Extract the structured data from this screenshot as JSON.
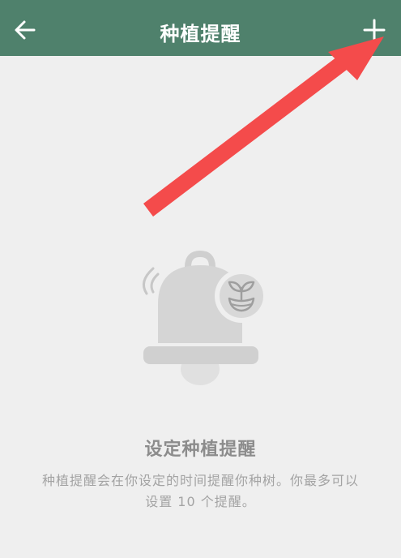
{
  "header": {
    "title": "种植提醒",
    "back_icon": "arrow-left-icon",
    "add_icon": "plus-icon",
    "background_color": "#4f816c"
  },
  "annotation": {
    "arrow_color": "#f44b4b",
    "points_to": "add-button"
  },
  "empty_state": {
    "illustration_icon": "bell-with-sprout-icon",
    "title": "设定种植提醒",
    "description": "种植提醒会在你设定的时间提醒你种树。你最多可以设置 10 个提醒。"
  }
}
